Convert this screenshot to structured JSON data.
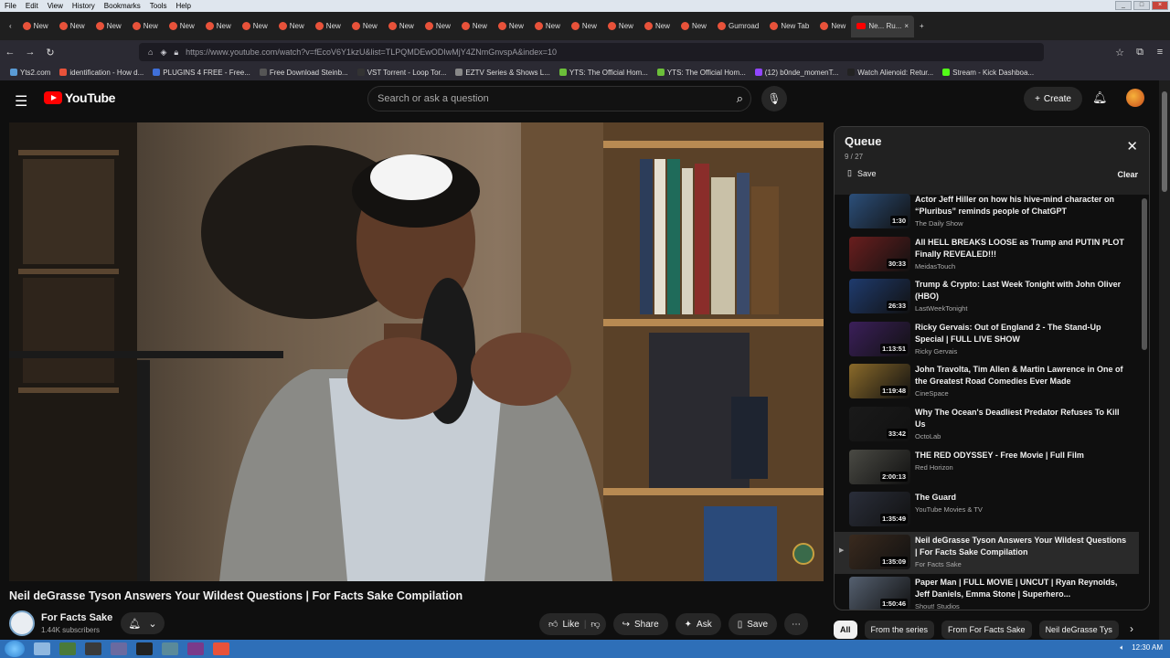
{
  "menubar": {
    "items": [
      "File",
      "Edit",
      "View",
      "History",
      "Bookmarks",
      "Tools",
      "Help"
    ]
  },
  "tabs": {
    "items": [
      "New",
      "New",
      "New",
      "New",
      "New",
      "New",
      "New",
      "New",
      "New",
      "New",
      "New",
      "New",
      "New",
      "New",
      "New",
      "New",
      "New",
      "New",
      "New",
      "Gumroad",
      "New Tab",
      "New"
    ],
    "active": "Ne... Ru..."
  },
  "address": {
    "url": "https://www.youtube.com/watch?v=fEcoV6Y1kzU&list=TLPQMDEwODIwMjY4ZNmGnvspA&index=10"
  },
  "bookmarks": [
    {
      "label": "Yts2.com",
      "color": "#5a9bd5"
    },
    {
      "label": "identification - How d...",
      "color": "#e8523a"
    },
    {
      "label": "PLUGINS 4 FREE - Free...",
      "color": "#3f6fd8"
    },
    {
      "label": "Free Download Steinb...",
      "color": "#555555"
    },
    {
      "label": "VST Torrent - Loop Tor...",
      "color": "#333333"
    },
    {
      "label": "EZTV Series & Shows L...",
      "color": "#888888"
    },
    {
      "label": "YTS: The Official Hom...",
      "color": "#6cbf3a"
    },
    {
      "label": "YTS: The Official Hom...",
      "color": "#6cbf3a"
    },
    {
      "label": "(12) b0nde_momenT...",
      "color": "#9146ff"
    },
    {
      "label": "Watch Alienoid: Retur...",
      "color": "#222222"
    },
    {
      "label": "Stream - Kick Dashboa...",
      "color": "#53fc18"
    }
  ],
  "youtube": {
    "logo": "YouTube",
    "search_placeholder": "Search or ask a question",
    "create_label": "Create"
  },
  "video": {
    "title": "Neil deGrasse Tyson Answers Your Wildest Questions | For Facts Sake Compilation",
    "channel": "For Facts Sake",
    "subscribers": "1.44K subscribers",
    "like_label": "Like",
    "share_label": "Share",
    "ask_label": "Ask",
    "save_label": "Save"
  },
  "queue": {
    "title": "Queue",
    "count": "9 / 27",
    "save_label": "Save",
    "clear_label": "Clear",
    "items": [
      {
        "title": "Actor Jeff Hiller on how his hive-mind character on “Pluribus” reminds people of ChatGPT",
        "channel": "The Daily Show",
        "duration": "1:30",
        "color": "#2c4f7a"
      },
      {
        "title": "All HELL BREAKS LOOSE as Trump and PUTIN PLOT Finally REVEALED!!!",
        "channel": "MeidasTouch",
        "duration": "30:33",
        "color": "#6a1e1e"
      },
      {
        "title": "Trump & Crypto: Last Week Tonight with John Oliver (HBO)",
        "channel": "LastWeekTonight",
        "duration": "26:33",
        "color": "#1f3b6e"
      },
      {
        "title": "Ricky Gervais: Out of England 2 - The Stand-Up Special | FULL LIVE SHOW",
        "channel": "Ricky Gervais",
        "duration": "1:13:51",
        "color": "#3b1f5a"
      },
      {
        "title": "John Travolta, Tim Allen & Martin Lawrence in One of the Greatest Road Comedies Ever Made",
        "channel": "CineSpace",
        "duration": "1:19:48",
        "color": "#8a6a2a"
      },
      {
        "title": "Why The Ocean's Deadliest Predator Refuses To Kill Us",
        "channel": "OctoLab",
        "duration": "33:42",
        "color": "#1a1a1a"
      },
      {
        "title": "THE RED ODYSSEY - Free Movie | Full Film",
        "channel": "Red Horizon",
        "duration": "2:00:13",
        "color": "#4a4a44"
      },
      {
        "title": "The Guard",
        "channel": "YouTube Movies & TV",
        "duration": "1:35:49",
        "color": "#2a2e3a"
      },
      {
        "title": "Neil deGrasse Tyson Answers Your Wildest Questions | For Facts Sake Compilation",
        "channel": "For Facts Sake",
        "duration": "1:35:09",
        "color": "#3a2a1e",
        "current": true
      },
      {
        "title": "Paper Man | FULL MOVIE | UNCUT | Ryan Reynolds, Jeff Daniels, Emma Stone | Superhero...",
        "channel": "Shout! Studios",
        "duration": "1:50:46",
        "color": "#556070"
      }
    ]
  },
  "chips": [
    "All",
    "From the series",
    "From For Facts Sake",
    "Neil deGrasse Tys"
  ],
  "taskbar": {
    "time": "12:30 AM"
  }
}
